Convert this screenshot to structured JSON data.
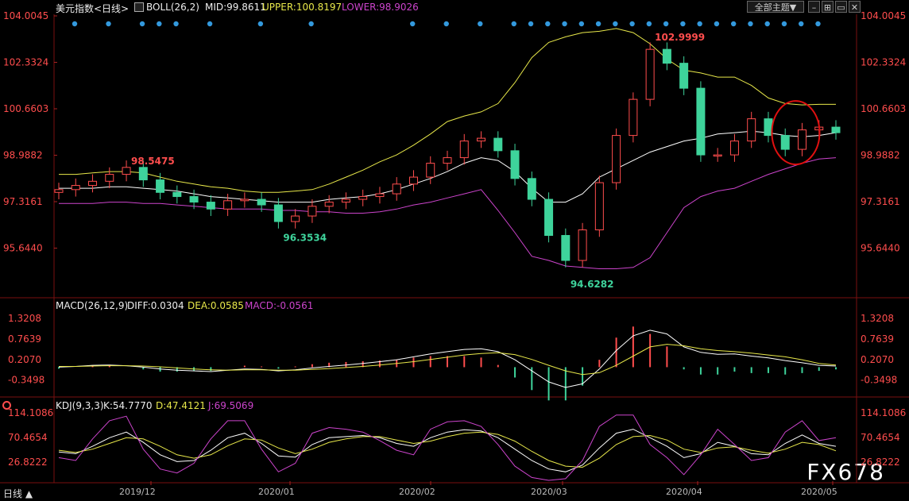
{
  "header": {
    "title": "美元指数<日线>",
    "boll_label": "BOLL(26,2)",
    "mid": "MID:99.8611",
    "upper": "UPPER:100.8197",
    "lower": "LOWER:98.9026",
    "theme_button": "全部主题▼"
  },
  "macd_header": {
    "label": "MACD(26,12,9)",
    "diff": "DIFF:0.0304",
    "dea": "DEA:0.0585",
    "macd": "MACD:-0.0561"
  },
  "kdj_header": {
    "label": "KDJ(9,3,3)",
    "k": "K:54.7770",
    "d": "D:47.4121",
    "j": "J:69.5069"
  },
  "footer": {
    "period": "日线 ▲",
    "watermark": "FX678"
  },
  "colors": {
    "up": "#ff4d4d",
    "down": "#3ed39b",
    "mid": "#ffffff",
    "upper": "#e8e84a",
    "lower": "#cc44cc",
    "dea": "#e8e84a",
    "j": "#cc44cc",
    "marker": "#3399dd",
    "circle": "#e01010"
  },
  "chart_data": [
    {
      "type": "candlestick",
      "title": "美元指数<日线>",
      "y_ticks": [
        "104.0045",
        "102.3324",
        "100.6603",
        "98.9882",
        "97.3161",
        "95.6440"
      ],
      "ylim": [
        94.0,
        104.0045
      ],
      "x_ticks": [
        "2019/12",
        "2020/01",
        "2020/02",
        "2020/03",
        "2020/04",
        "2020/05"
      ],
      "annotations": [
        "98.5475",
        "96.3534",
        "94.6282",
        "102.9999"
      ],
      "series": [
        {
          "name": "MID",
          "values": [
            97.8,
            97.8,
            97.8,
            97.85,
            97.85,
            97.8,
            97.75,
            97.7,
            97.6,
            97.5,
            97.45,
            97.4,
            97.35,
            97.3,
            97.3,
            97.3,
            97.4,
            97.45,
            97.5,
            97.6,
            97.75,
            97.95,
            98.15,
            98.4,
            98.7,
            98.9,
            98.8,
            98.4,
            97.8,
            97.3,
            97.3,
            97.6,
            98.2,
            98.5,
            98.8,
            99.1,
            99.3,
            99.5,
            99.6,
            99.75,
            99.8,
            99.85,
            99.8,
            99.7,
            99.65,
            99.7,
            99.8
          ]
        },
        {
          "name": "UPPER",
          "values": [
            98.3,
            98.3,
            98.35,
            98.4,
            98.4,
            98.35,
            98.2,
            98.05,
            97.95,
            97.85,
            97.8,
            97.7,
            97.65,
            97.65,
            97.7,
            97.75,
            97.95,
            98.2,
            98.45,
            98.75,
            99.0,
            99.35,
            99.75,
            100.2,
            100.4,
            100.55,
            100.85,
            101.6,
            102.5,
            103.05,
            103.25,
            103.4,
            103.45,
            103.55,
            103.4,
            103.0,
            102.45,
            102.05,
            101.95,
            101.8,
            101.8,
            101.5,
            101.05,
            100.85,
            100.8,
            100.82,
            100.82
          ]
        },
        {
          "name": "LOWER",
          "values": [
            97.25,
            97.25,
            97.25,
            97.3,
            97.3,
            97.25,
            97.25,
            97.2,
            97.15,
            97.1,
            97.05,
            97.05,
            97.05,
            97.0,
            97.0,
            96.95,
            96.95,
            96.9,
            96.9,
            96.95,
            97.05,
            97.2,
            97.3,
            97.45,
            97.6,
            97.75,
            97.0,
            96.2,
            95.35,
            95.2,
            95.0,
            94.95,
            94.9,
            94.9,
            94.95,
            95.3,
            96.2,
            97.1,
            97.5,
            97.7,
            97.8,
            98.05,
            98.3,
            98.5,
            98.7,
            98.85,
            98.9
          ]
        },
        {
          "name": "close",
          "values": [
            97.75,
            97.9,
            98.05,
            98.3,
            98.55,
            98.1,
            97.65,
            97.5,
            97.3,
            97.05,
            97.35,
            97.4,
            97.2,
            96.6,
            96.8,
            97.15,
            97.3,
            97.4,
            97.5,
            97.6,
            97.95,
            98.2,
            98.7,
            98.9,
            99.5,
            99.6,
            99.15,
            98.15,
            97.4,
            96.1,
            95.2,
            96.3,
            98.0,
            99.7,
            101.0,
            102.8,
            102.3,
            101.4,
            99.0,
            99.0,
            99.5,
            100.3,
            99.7,
            99.2,
            99.9,
            100.0,
            99.8
          ]
        }
      ]
    },
    {
      "type": "bar",
      "title": "MACD(26,12,9)",
      "y_ticks": [
        "1.3208",
        "0.7639",
        "0.2070",
        "-0.3498"
      ],
      "ylim": [
        -0.7,
        1.45
      ],
      "series": [
        {
          "name": "DIFF",
          "values": [
            0.0,
            0.02,
            0.05,
            0.06,
            0.04,
            0.0,
            -0.05,
            -0.08,
            -0.1,
            -0.12,
            -0.08,
            -0.05,
            -0.06,
            -0.1,
            -0.07,
            -0.02,
            0.02,
            0.06,
            0.1,
            0.15,
            0.2,
            0.28,
            0.36,
            0.42,
            0.48,
            0.5,
            0.42,
            0.2,
            -0.1,
            -0.4,
            -0.55,
            -0.45,
            -0.05,
            0.45,
            0.85,
            1.0,
            0.9,
            0.55,
            0.4,
            0.35,
            0.36,
            0.3,
            0.25,
            0.18,
            0.12,
            0.05,
            0.03
          ]
        },
        {
          "name": "DEA",
          "values": [
            0.02,
            0.02,
            0.03,
            0.04,
            0.04,
            0.03,
            0.01,
            -0.02,
            -0.05,
            -0.07,
            -0.08,
            -0.07,
            -0.07,
            -0.08,
            -0.08,
            -0.06,
            -0.04,
            -0.01,
            0.02,
            0.06,
            0.1,
            0.15,
            0.21,
            0.27,
            0.33,
            0.37,
            0.39,
            0.34,
            0.21,
            0.05,
            -0.1,
            -0.2,
            -0.15,
            0.05,
            0.3,
            0.55,
            0.62,
            0.58,
            0.5,
            0.45,
            0.42,
            0.38,
            0.33,
            0.28,
            0.2,
            0.1,
            0.06
          ]
        },
        {
          "name": "MACD",
          "values": [
            -0.04,
            0.0,
            0.04,
            0.04,
            0.0,
            -0.06,
            -0.12,
            -0.12,
            -0.1,
            -0.1,
            0.0,
            0.04,
            0.02,
            -0.04,
            0.02,
            0.08,
            0.12,
            0.14,
            0.16,
            0.18,
            0.2,
            0.26,
            0.3,
            0.3,
            0.3,
            0.26,
            0.06,
            -0.28,
            -0.62,
            -0.9,
            -0.9,
            -0.5,
            0.2,
            0.8,
            1.1,
            0.9,
            0.56,
            -0.06,
            -0.2,
            -0.2,
            -0.12,
            -0.16,
            -0.16,
            -0.2,
            -0.16,
            -0.1,
            -0.06
          ]
        }
      ]
    },
    {
      "type": "line",
      "title": "KDJ(9,3,3)",
      "y_ticks": [
        "114.1086",
        "70.4654",
        "26.8222"
      ],
      "ylim": [
        -5,
        125
      ],
      "series": [
        {
          "name": "K",
          "values": [
            45,
            42,
            55,
            70,
            80,
            62,
            40,
            28,
            30,
            48,
            70,
            78,
            60,
            38,
            36,
            58,
            70,
            72,
            74,
            70,
            60,
            55,
            70,
            80,
            84,
            82,
            70,
            50,
            30,
            15,
            10,
            22,
            52,
            78,
            85,
            70,
            55,
            35,
            42,
            62,
            55,
            42,
            40,
            60,
            75,
            60,
            55
          ]
        },
        {
          "name": "D",
          "values": [
            48,
            44,
            50,
            60,
            70,
            68,
            55,
            40,
            34,
            40,
            56,
            68,
            66,
            52,
            42,
            50,
            62,
            68,
            72,
            72,
            66,
            60,
            64,
            72,
            78,
            80,
            76,
            64,
            46,
            30,
            20,
            18,
            34,
            58,
            72,
            74,
            66,
            50,
            44,
            52,
            54,
            48,
            43,
            50,
            62,
            58,
            47
          ]
        },
        {
          "name": "J",
          "values": [
            35,
            30,
            68,
            100,
            108,
            50,
            15,
            8,
            25,
            68,
            100,
            100,
            50,
            10,
            25,
            78,
            88,
            85,
            80,
            65,
            48,
            40,
            85,
            98,
            100,
            90,
            58,
            20,
            0,
            -5,
            -2,
            30,
            90,
            110,
            110,
            58,
            35,
            5,
            40,
            85,
            58,
            30,
            35,
            80,
            100,
            65,
            70
          ]
        }
      ]
    }
  ]
}
